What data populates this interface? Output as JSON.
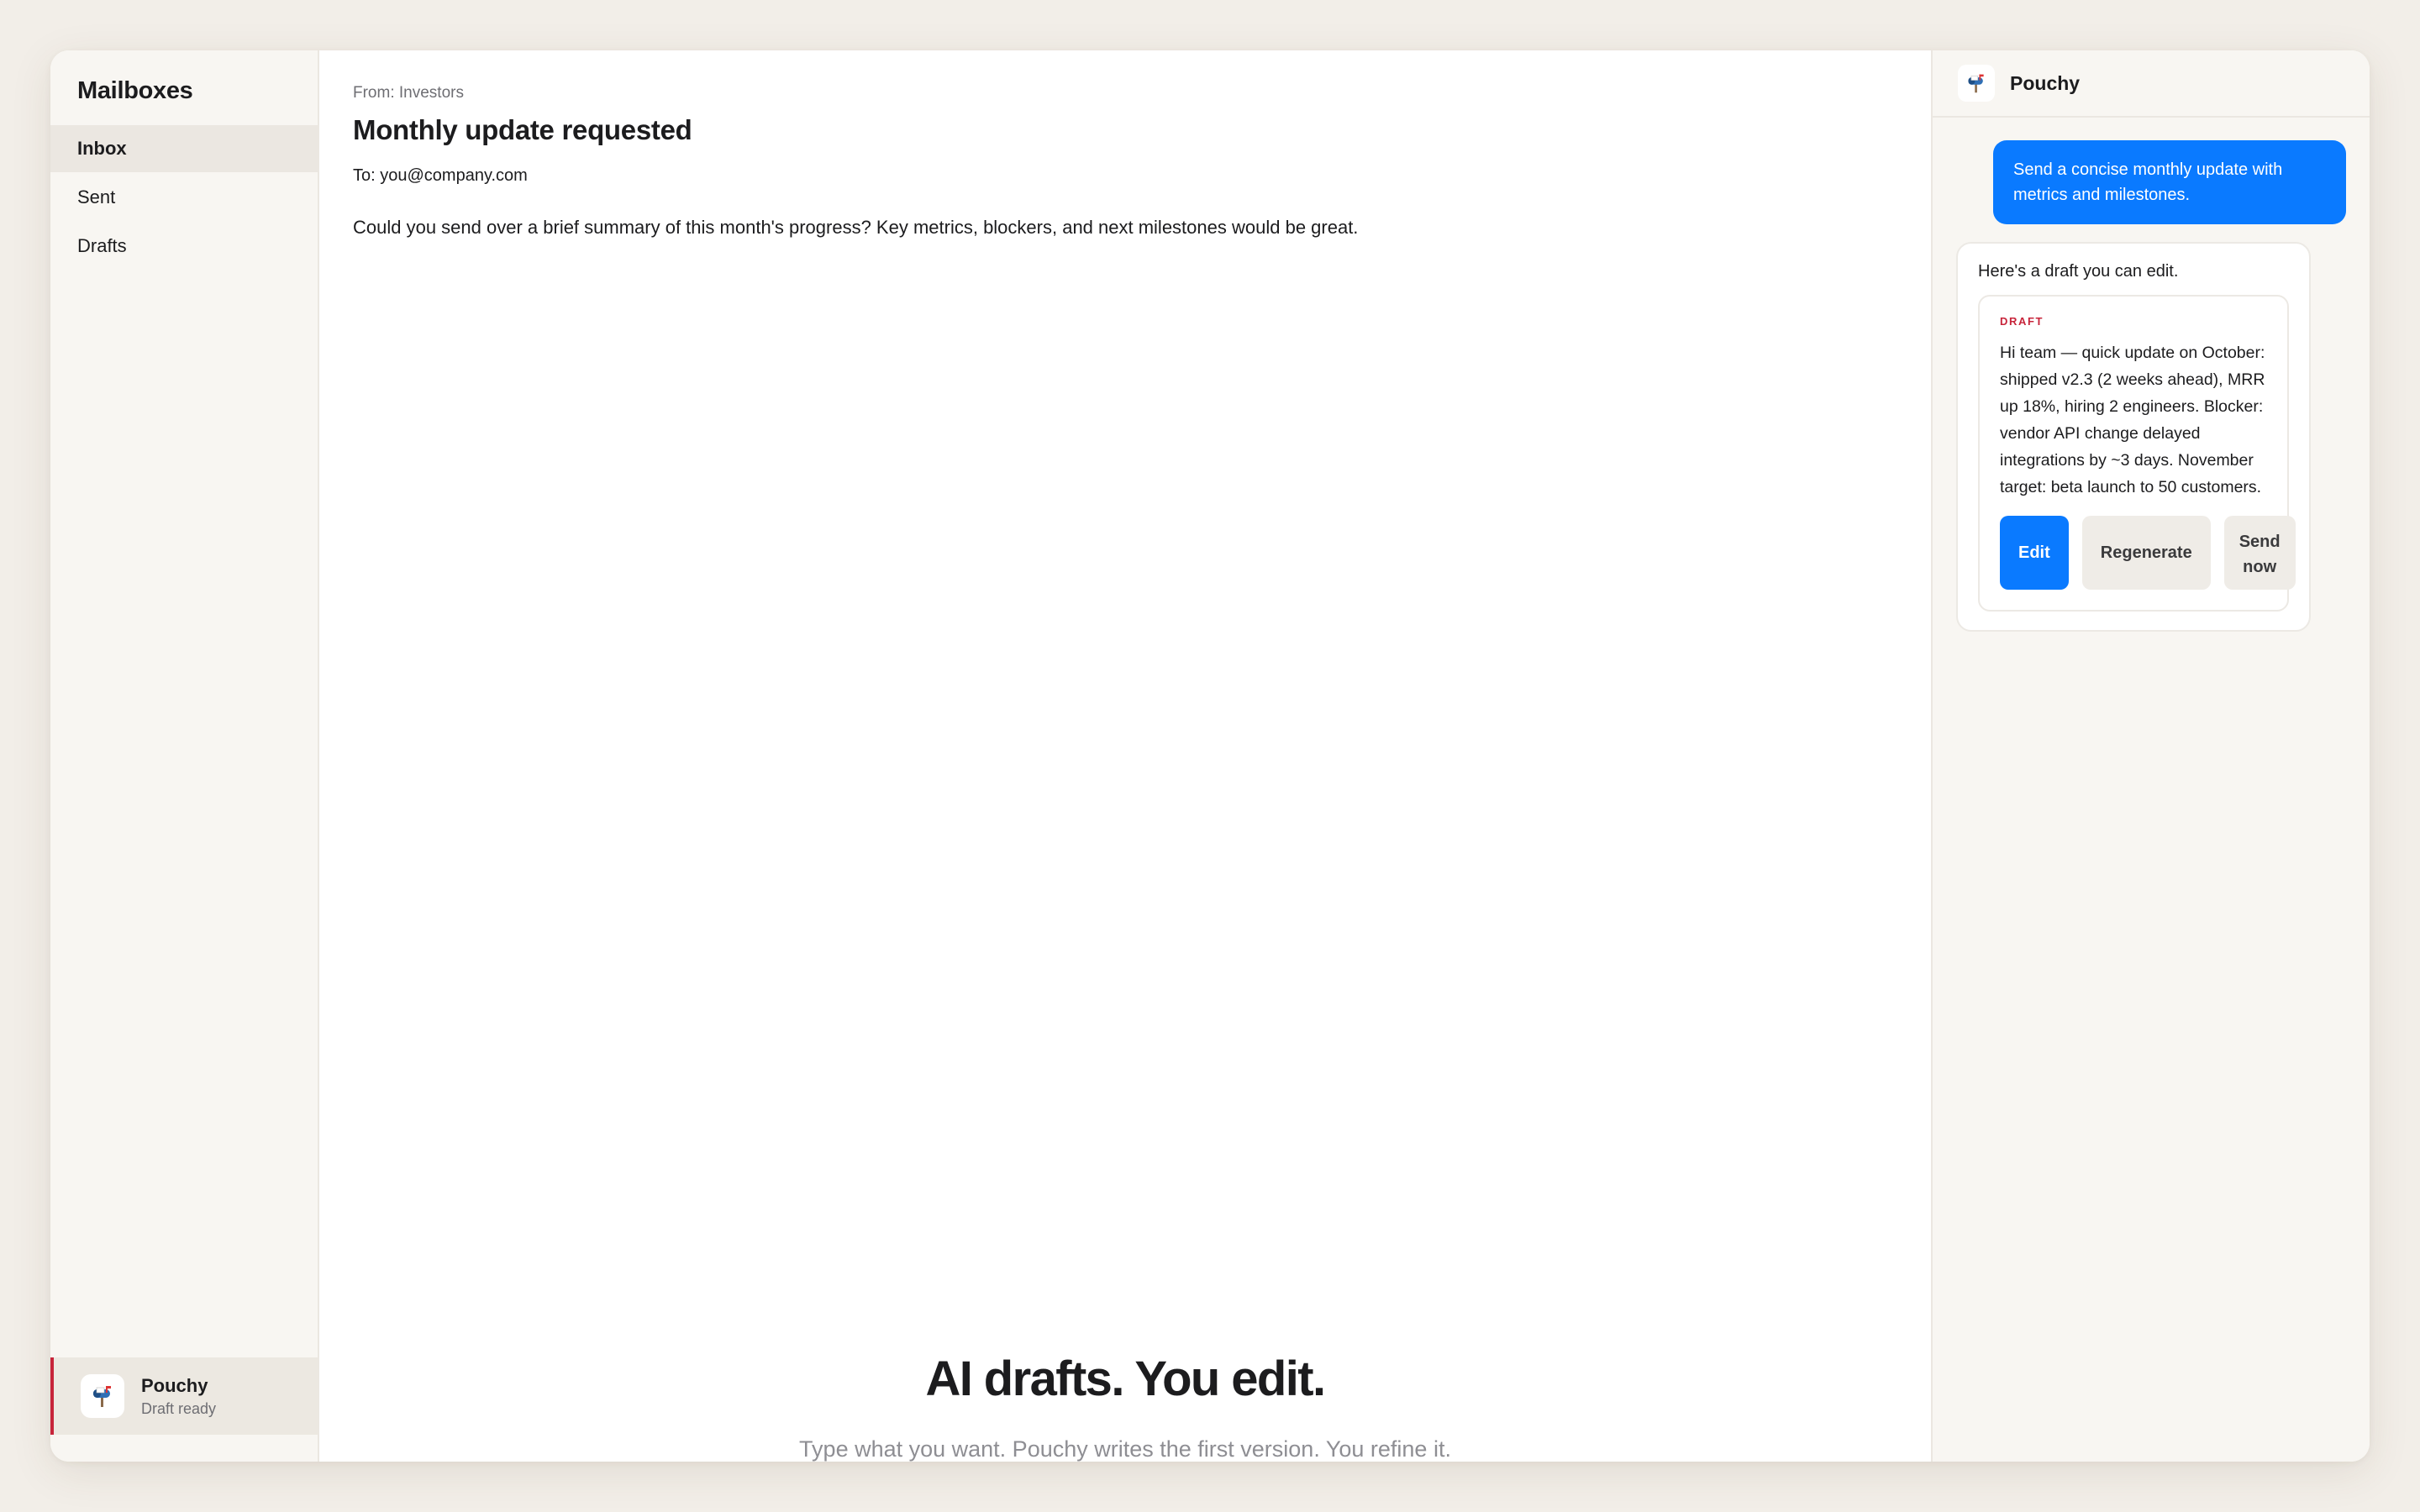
{
  "sidebar": {
    "title": "Mailboxes",
    "items": [
      {
        "label": "Inbox"
      },
      {
        "label": "Sent"
      },
      {
        "label": "Drafts"
      }
    ],
    "assistant": {
      "name": "Pouchy",
      "status": "Draft ready",
      "icon": "mailbox-icon"
    }
  },
  "email": {
    "from": "From: Investors",
    "subject": "Monthly update requested",
    "to": "To: you@company.com",
    "body": "Could you send over a brief summary of this month's progress? Key metrics, blockers, and next milestones would be great."
  },
  "hero": {
    "title": "AI drafts. You edit.",
    "subtitle": "Type what you want. Pouchy writes the first version. You refine it."
  },
  "panel": {
    "title": "Pouchy",
    "icon": "mailbox-icon",
    "user_message": "Send a concise monthly update with metrics and milestones.",
    "ai_intro": "Here's a draft you can edit.",
    "draft": {
      "label": "DRAFT",
      "text": "Hi team — quick update on October: shipped v2.3 (2 weeks ahead), MRR up 18%, hiring 2 engineers. Blocker: vendor API change delayed integrations by ~3 days. November target: beta launch to 50 customers.",
      "actions": {
        "edit": "Edit",
        "regenerate": "Regenerate",
        "send": "Send now"
      }
    }
  },
  "colors": {
    "accent": "#0a7aff",
    "draft_label": "#c7243a",
    "background": "#f2eee8"
  }
}
